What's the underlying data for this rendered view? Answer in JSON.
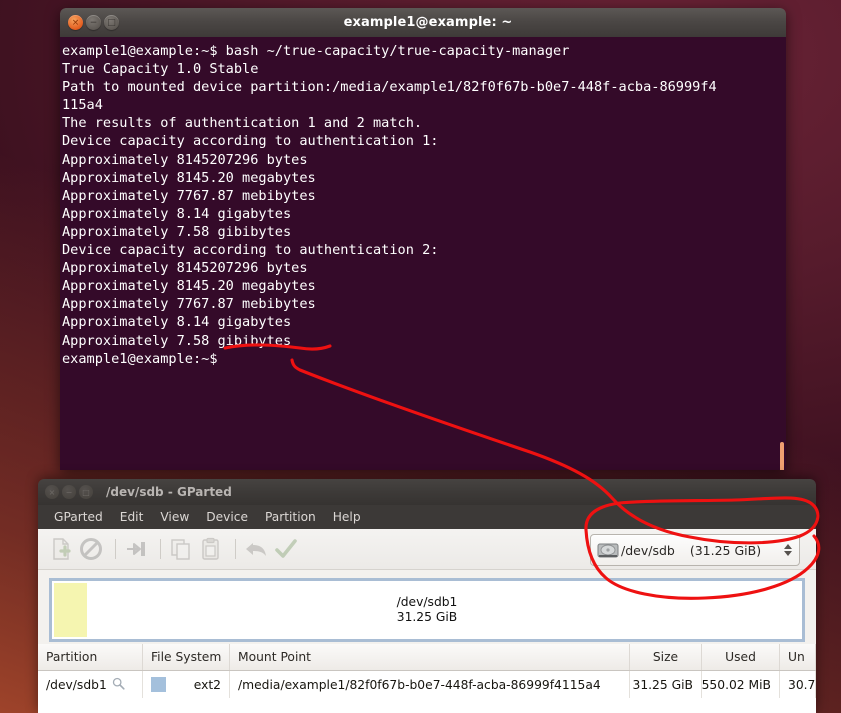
{
  "desktop": {
    "background_color": "#4a1428",
    "accent_color": "#a8462c"
  },
  "terminal": {
    "title": "example1@example: ~",
    "window_buttons": {
      "close": "×",
      "minimize": "−",
      "maximize": "□"
    },
    "background_color": "#340a29",
    "text_color": "#ffffff",
    "lines": [
      "example1@example:~$ bash ~/true-capacity/true-capacity-manager",
      "True Capacity 1.0 Stable",
      "Path to mounted device partition:/media/example1/82f0f67b-b0e7-448f-acba-86999f4",
      "115a4",
      "The results of authentication 1 and 2 match.",
      "Device capacity according to authentication 1:",
      "Approximately 8145207296 bytes",
      "Approximately 8145.20 megabytes",
      "Approximately 7767.87 mebibytes",
      "Approximately 8.14 gigabytes",
      "Approximately 7.58 gibibytes",
      "Device capacity according to authentication 2:",
      "Approximately 8145207296 bytes",
      "Approximately 8145.20 megabytes",
      "Approximately 7767.87 mebibytes",
      "Approximately 8.14 gigabytes",
      "Approximately 7.58 gibibytes",
      "example1@example:~$"
    ]
  },
  "gparted": {
    "title": "/dev/sdb - GParted",
    "window_buttons": {
      "close": "×",
      "minimize": "−",
      "maximize": "□"
    },
    "menu": [
      {
        "label": "GParted"
      },
      {
        "label": "Edit"
      },
      {
        "label": "View"
      },
      {
        "label": "Device"
      },
      {
        "label": "Partition"
      },
      {
        "label": "Help"
      }
    ],
    "toolbar": [
      {
        "icon": "new-partition-icon"
      },
      {
        "icon": "delete-partition-icon"
      },
      {
        "icon": "resize-move-icon"
      },
      {
        "icon": "copy-icon"
      },
      {
        "icon": "paste-icon"
      },
      {
        "icon": "undo-icon"
      },
      {
        "icon": "apply-icon"
      }
    ],
    "device_select": {
      "icon": "hard-disk-icon",
      "device": "/dev/sdb",
      "size": "(31.25 GiB)"
    },
    "disk_graphic": {
      "partition_name": "/dev/sdb1",
      "partition_size": "31.25 GiB",
      "used_color": "#f5f5b0",
      "border_color": "#a9bdd4"
    },
    "table": {
      "headers": [
        "Partition",
        "File System",
        "Mount Point",
        "Size",
        "Used",
        "Un"
      ],
      "rows": [
        {
          "partition": "/dev/sdb1",
          "magnifier": "magnifier-icon",
          "fs_color": "#a4c0dc",
          "file_system": "ext2",
          "mount_point": "/media/example1/82f0f67b-b0e7-448f-acba-86999f4115a4",
          "size": "31.25 GiB",
          "used": "550.02 MiB",
          "unused": "30.7"
        }
      ]
    }
  },
  "annotations": {
    "color": "#ee1111",
    "shapes": [
      {
        "type": "underline",
        "target": "terminal gibibytes line"
      },
      {
        "type": "arrow-line",
        "target": "from terminal to device selector"
      },
      {
        "type": "ellipse",
        "target": "device selector dropdown"
      }
    ]
  }
}
